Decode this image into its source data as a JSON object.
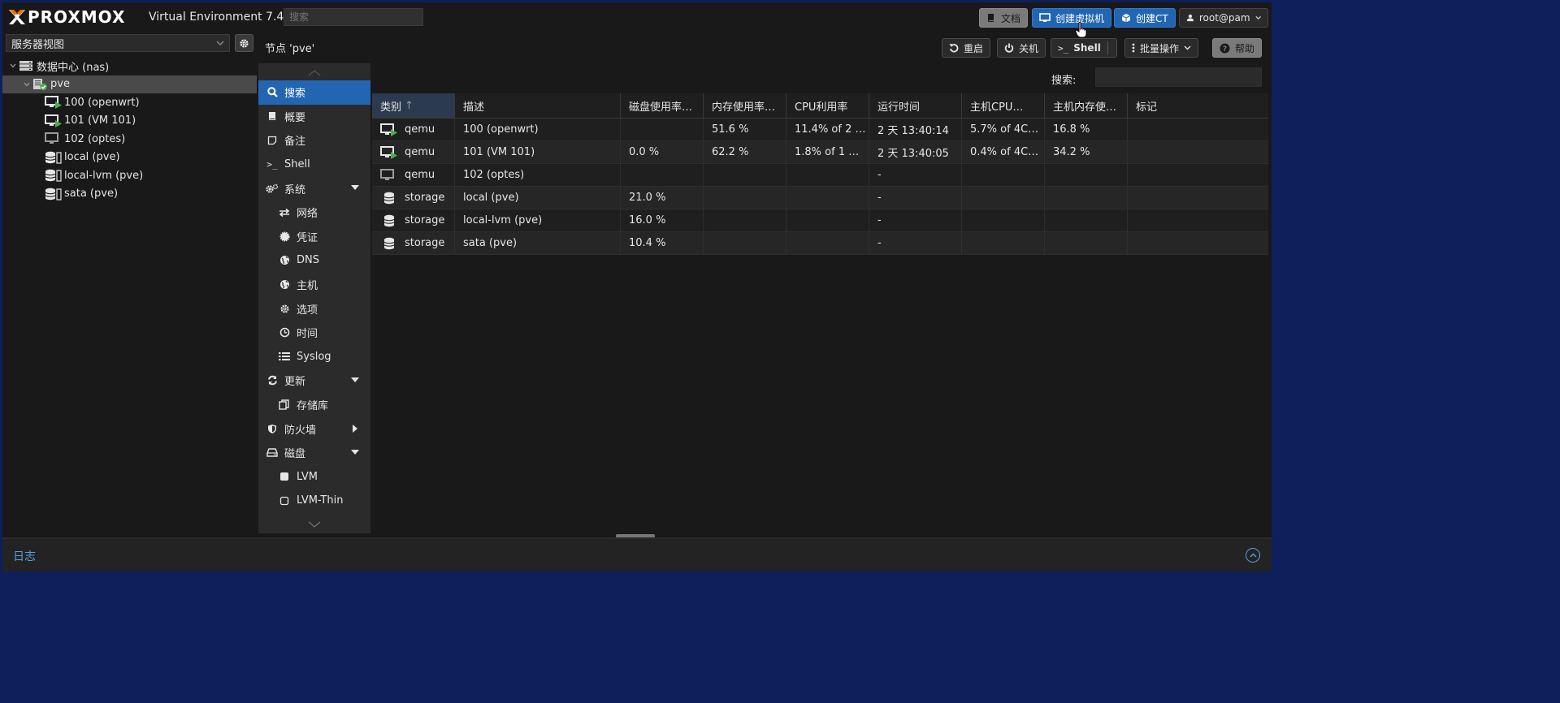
{
  "header": {
    "brand": "PROXMOX",
    "version": "Virtual Environment 7.4-3",
    "search_placeholder": "搜索",
    "buttons": {
      "docs": "文档",
      "create_vm": "创建虚拟机",
      "create_ct": "创建CT",
      "user": "root@pam"
    }
  },
  "sidebar": {
    "view_select": "服务器视图",
    "tree": [
      {
        "label": "数据中心 (nas)",
        "icon": "datacenter-icon"
      },
      {
        "label": "pve",
        "icon": "node-online-icon"
      },
      {
        "label": "100 (openwrt)",
        "icon": "vm-running-icon"
      },
      {
        "label": "101 (VM 101)",
        "icon": "vm-running-icon"
      },
      {
        "label": "102 (optes)",
        "icon": "vm-stopped-icon"
      },
      {
        "label": "local (pve)",
        "icon": "storage-icon"
      },
      {
        "label": "local-lvm (pve)",
        "icon": "storage-icon"
      },
      {
        "label": "sata (pve)",
        "icon": "storage-icon"
      }
    ]
  },
  "node": {
    "title": "节点 'pve'",
    "actions": {
      "reboot": "重启",
      "shutdown": "关机",
      "shell": "Shell",
      "bulk": "批量操作",
      "help": "帮助"
    }
  },
  "nav": {
    "items": [
      {
        "label": "搜索",
        "icon": "search-icon",
        "selected": true
      },
      {
        "label": "概要",
        "icon": "book-icon"
      },
      {
        "label": "备注",
        "icon": "note-icon"
      },
      {
        "label": "Shell",
        "icon": "terminal-icon"
      },
      {
        "label": "系统",
        "icon": "cogs-icon",
        "expand": "down"
      },
      {
        "label": "网络",
        "icon": "network-icon",
        "sub": true
      },
      {
        "label": "凭证",
        "icon": "certificate-icon",
        "sub": true
      },
      {
        "label": "DNS",
        "icon": "globe-icon",
        "sub": true
      },
      {
        "label": "主机",
        "icon": "globe-icon",
        "sub": true
      },
      {
        "label": "选项",
        "icon": "gear-icon",
        "sub": true
      },
      {
        "label": "时间",
        "icon": "clock-icon",
        "sub": true
      },
      {
        "label": "Syslog",
        "icon": "list-icon",
        "sub": true
      },
      {
        "label": "更新",
        "icon": "refresh-icon",
        "expand": "down"
      },
      {
        "label": "存储库",
        "icon": "files-icon",
        "sub": true
      },
      {
        "label": "防火墙",
        "icon": "shield-icon",
        "expand": "right"
      },
      {
        "label": "磁盘",
        "icon": "hdd-icon",
        "expand": "down"
      },
      {
        "label": "LVM",
        "icon": "lvm-icon",
        "sub": true
      },
      {
        "label": "LVM-Thin",
        "icon": "lvm-thin-icon",
        "sub": true
      }
    ]
  },
  "search": {
    "label": "搜索:",
    "value": ""
  },
  "grid": {
    "columns": [
      "类别",
      "描述",
      "磁盘使用率…",
      "内存使用率…",
      "CPU利用率",
      "运行时间",
      "主机CPU…",
      "主机内存使…",
      "标记"
    ],
    "sort_indicator": "↑",
    "rows": [
      {
        "type": "qemu",
        "icon": "vm-running-icon",
        "desc": "100 (openwrt)",
        "disk": "",
        "mem": "51.6 %",
        "cpu": "11.4% of 2 …",
        "uptime": "2 天 13:40:14",
        "hostcpu": "5.7% of 4C…",
        "hostmem": "16.8 %",
        "tags": ""
      },
      {
        "type": "qemu",
        "icon": "vm-running-icon",
        "desc": "101 (VM 101)",
        "disk": "0.0 %",
        "mem": "62.2 %",
        "cpu": "1.8% of 1 …",
        "uptime": "2 天 13:40:05",
        "hostcpu": "0.4% of 4C…",
        "hostmem": "34.2 %",
        "tags": ""
      },
      {
        "type": "qemu",
        "icon": "vm-stopped-icon",
        "desc": "102 (optes)",
        "disk": "",
        "mem": "",
        "cpu": "",
        "uptime": "-",
        "hostcpu": "",
        "hostmem": "",
        "tags": ""
      },
      {
        "type": "storage",
        "icon": "storage-icon",
        "desc": "local (pve)",
        "disk": "21.0 %",
        "mem": "",
        "cpu": "",
        "uptime": "-",
        "hostcpu": "",
        "hostmem": "",
        "tags": ""
      },
      {
        "type": "storage",
        "icon": "storage-icon",
        "desc": "local-lvm (pve)",
        "disk": "16.0 %",
        "mem": "",
        "cpu": "",
        "uptime": "-",
        "hostcpu": "",
        "hostmem": "",
        "tags": ""
      },
      {
        "type": "storage",
        "icon": "storage-icon",
        "desc": "sata (pve)",
        "disk": "10.4 %",
        "mem": "",
        "cpu": "",
        "uptime": "-",
        "hostcpu": "",
        "hostmem": "",
        "tags": ""
      }
    ]
  },
  "log": {
    "title": "日志"
  },
  "colors": {
    "accent": "#2266b3",
    "running": "#4caf50",
    "background": "#191919"
  }
}
